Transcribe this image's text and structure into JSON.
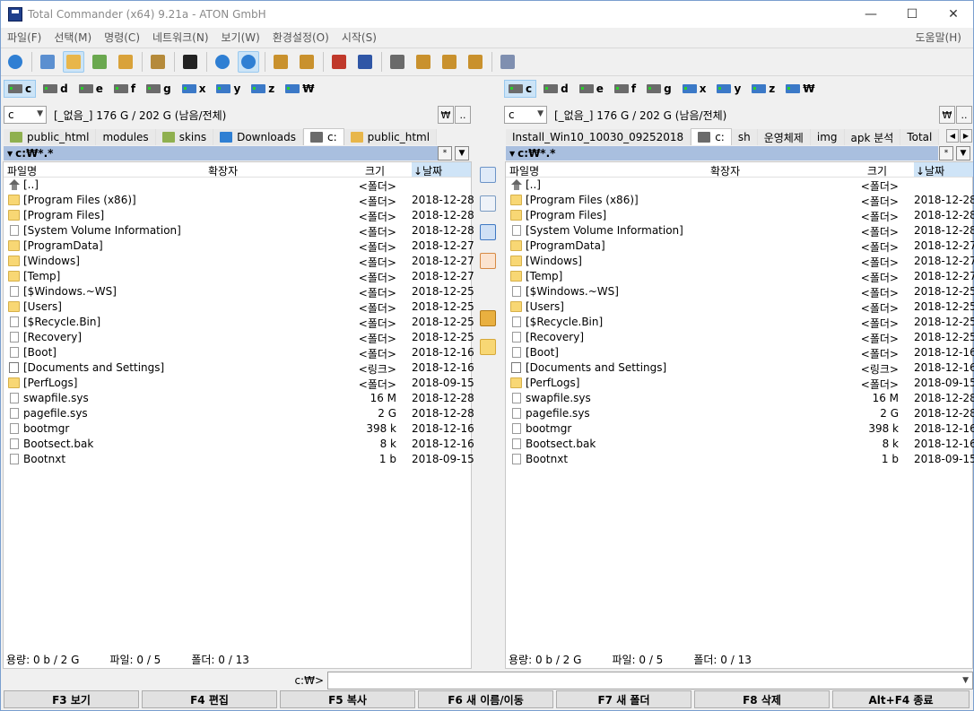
{
  "window": {
    "title": "Total Commander (x64) 9.21a - ATON GmbH"
  },
  "menu": [
    "파일(F)",
    "선택(M)",
    "명령(C)",
    "네트워크(N)",
    "보기(W)",
    "환경설정(O)",
    "시작(S)"
  ],
  "menu_help": "도움말(H)",
  "drives": [
    "c",
    "d",
    "e",
    "f",
    "g",
    "x",
    "y",
    "z",
    "₩"
  ],
  "left": {
    "drive_combo": "c",
    "drive_info": "[_없음_]  176 G / 202 G (남음/전체)",
    "root_btn": "₩",
    "up_btn": "..",
    "tabs": [
      "public_html",
      "modules",
      "skins",
      "Downloads",
      "c:",
      "public_html"
    ],
    "path": "c:₩*.*",
    "status": {
      "size": "용량: 0 b / 2 G",
      "files": "파일: 0 / 5",
      "folders": "폴더: 0 / 13"
    }
  },
  "right": {
    "drive_combo": "c",
    "drive_info": "[_없음_]  176 G / 202 G (남음/전체)",
    "root_btn": "₩",
    "up_btn": "..",
    "tabs": [
      "Install_Win10_10030_09252018",
      "c:",
      "sh",
      "운영체제",
      "img",
      "apk 분석",
      "Total"
    ],
    "path": "c:₩*.*",
    "status": {
      "size": "용량: 0 b / 2 G",
      "files": "파일: 0 / 5",
      "folders": "폴더: 0 / 13"
    }
  },
  "path_buttons": {
    "star": "*",
    "hist": "▼"
  },
  "columns": {
    "name": "파일명",
    "ext": "확장자",
    "size": "크기",
    "date": "↓날짜"
  },
  "files": [
    {
      "name": "[..]",
      "size": "<폴더>",
      "date": "",
      "icon": "up"
    },
    {
      "name": "[Program Files (x86)]",
      "size": "<폴더>",
      "date": "2018-12-28",
      "icon": "folder"
    },
    {
      "name": "[Program Files]",
      "size": "<폴더>",
      "date": "2018-12-28",
      "icon": "folder"
    },
    {
      "name": "[System Volume Information]",
      "size": "<폴더>",
      "date": "2018-12-28",
      "icon": "sysfolder"
    },
    {
      "name": "[ProgramData]",
      "size": "<폴더>",
      "date": "2018-12-27",
      "icon": "folder"
    },
    {
      "name": "[Windows]",
      "size": "<폴더>",
      "date": "2018-12-27",
      "icon": "folder"
    },
    {
      "name": "[Temp]",
      "size": "<폴더>",
      "date": "2018-12-27",
      "icon": "folder"
    },
    {
      "name": "[$Windows.~WS]",
      "size": "<폴더>",
      "date": "2018-12-25",
      "icon": "sysfolder"
    },
    {
      "name": "[Users]",
      "size": "<폴더>",
      "date": "2018-12-25",
      "icon": "folder"
    },
    {
      "name": "[$Recycle.Bin]",
      "size": "<폴더>",
      "date": "2018-12-25",
      "icon": "sysfolder"
    },
    {
      "name": "[Recovery]",
      "size": "<폴더>",
      "date": "2018-12-25",
      "icon": "sysfolder"
    },
    {
      "name": "[Boot]",
      "size": "<폴더>",
      "date": "2018-12-16",
      "icon": "sysfolder"
    },
    {
      "name": "[Documents and Settings]",
      "size": "<링크>",
      "date": "2018-12-16",
      "icon": "link"
    },
    {
      "name": "[PerfLogs]",
      "size": "<폴더>",
      "date": "2018-09-15",
      "icon": "folder"
    },
    {
      "name": "swapfile.sys",
      "size": "16 M",
      "date": "2018-12-28",
      "icon": "file"
    },
    {
      "name": "pagefile.sys",
      "size": "2 G",
      "date": "2018-12-28",
      "icon": "file"
    },
    {
      "name": "bootmgr",
      "size": "398 k",
      "date": "2018-12-16",
      "icon": "file"
    },
    {
      "name": "Bootsect.bak",
      "size": "8 k",
      "date": "2018-12-16",
      "icon": "file"
    },
    {
      "name": "Bootnxt",
      "size": "1 b",
      "date": "2018-09-15",
      "icon": "file"
    }
  ],
  "cmdline": {
    "label": "c:₩>"
  },
  "fkeys": [
    "F3 보기",
    "F4 편집",
    "F5 복사",
    "F6 새 이름/이동",
    "F7 새 폴더",
    "F8 삭제",
    "Alt+F4 종료"
  ],
  "window_controls": {
    "minimize": "—",
    "maximize": "☐",
    "close": "✕"
  },
  "colors": {
    "path_bar": "#a9bfdf",
    "sort_column": "#cfe4f7",
    "selection": "#cce4f7"
  }
}
